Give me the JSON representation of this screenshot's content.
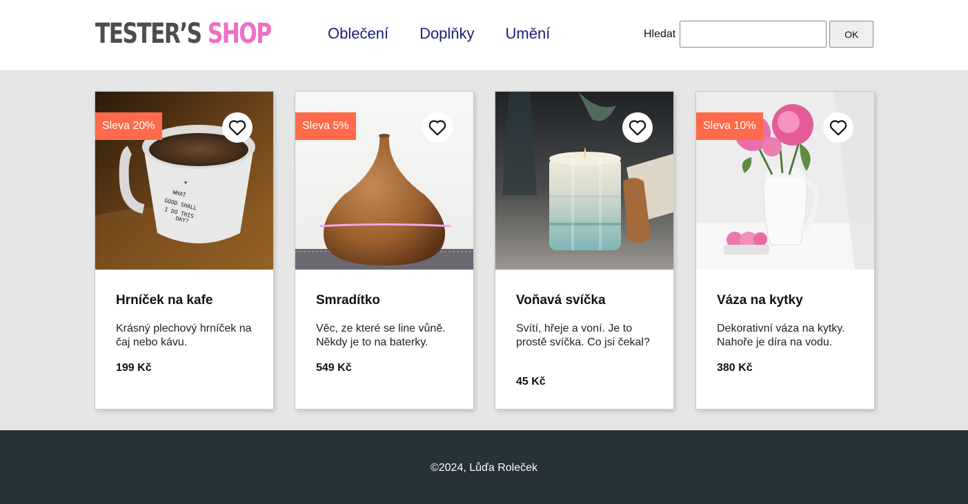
{
  "header": {
    "logo_part1": "TESTER’S",
    "logo_part2": "SHOP",
    "nav": [
      "Oblečení",
      "Doplňky",
      "Umění"
    ],
    "search_label": "Hledat",
    "search_value": "",
    "search_button": "OK"
  },
  "products": [
    {
      "title": "Hrníček na kafe",
      "description": "Krásný plechový hrníček na čaj nebo kávu.",
      "price": "199 Kč",
      "badge": "Sleva 20%"
    },
    {
      "title": "Smradítko",
      "description": "Věc, ze které se line vůně. Někdy je to na baterky.",
      "price": "549 Kč",
      "badge": "Sleva 5%"
    },
    {
      "title": "Voňavá svíčka",
      "description": "Svítí, hřeje a voní. Je to prostě svíčka. Co jsi čekal?",
      "price": "45 Kč",
      "badge": ""
    },
    {
      "title": "Váza na kytky",
      "description": "Dekorativní váza na kytky. Nahoře je díra na vodu.",
      "price": "380 Kč",
      "badge": "Sleva 10%"
    }
  ],
  "footer": {
    "text": "©2024, Lůďa Roleček"
  },
  "colors": {
    "badge": "#ff6b4a",
    "logo_accent": "#ef6ec6",
    "nav": "#1c1c7a",
    "footer_bg": "#263238"
  },
  "icons": {
    "favorite": "heart-icon"
  }
}
